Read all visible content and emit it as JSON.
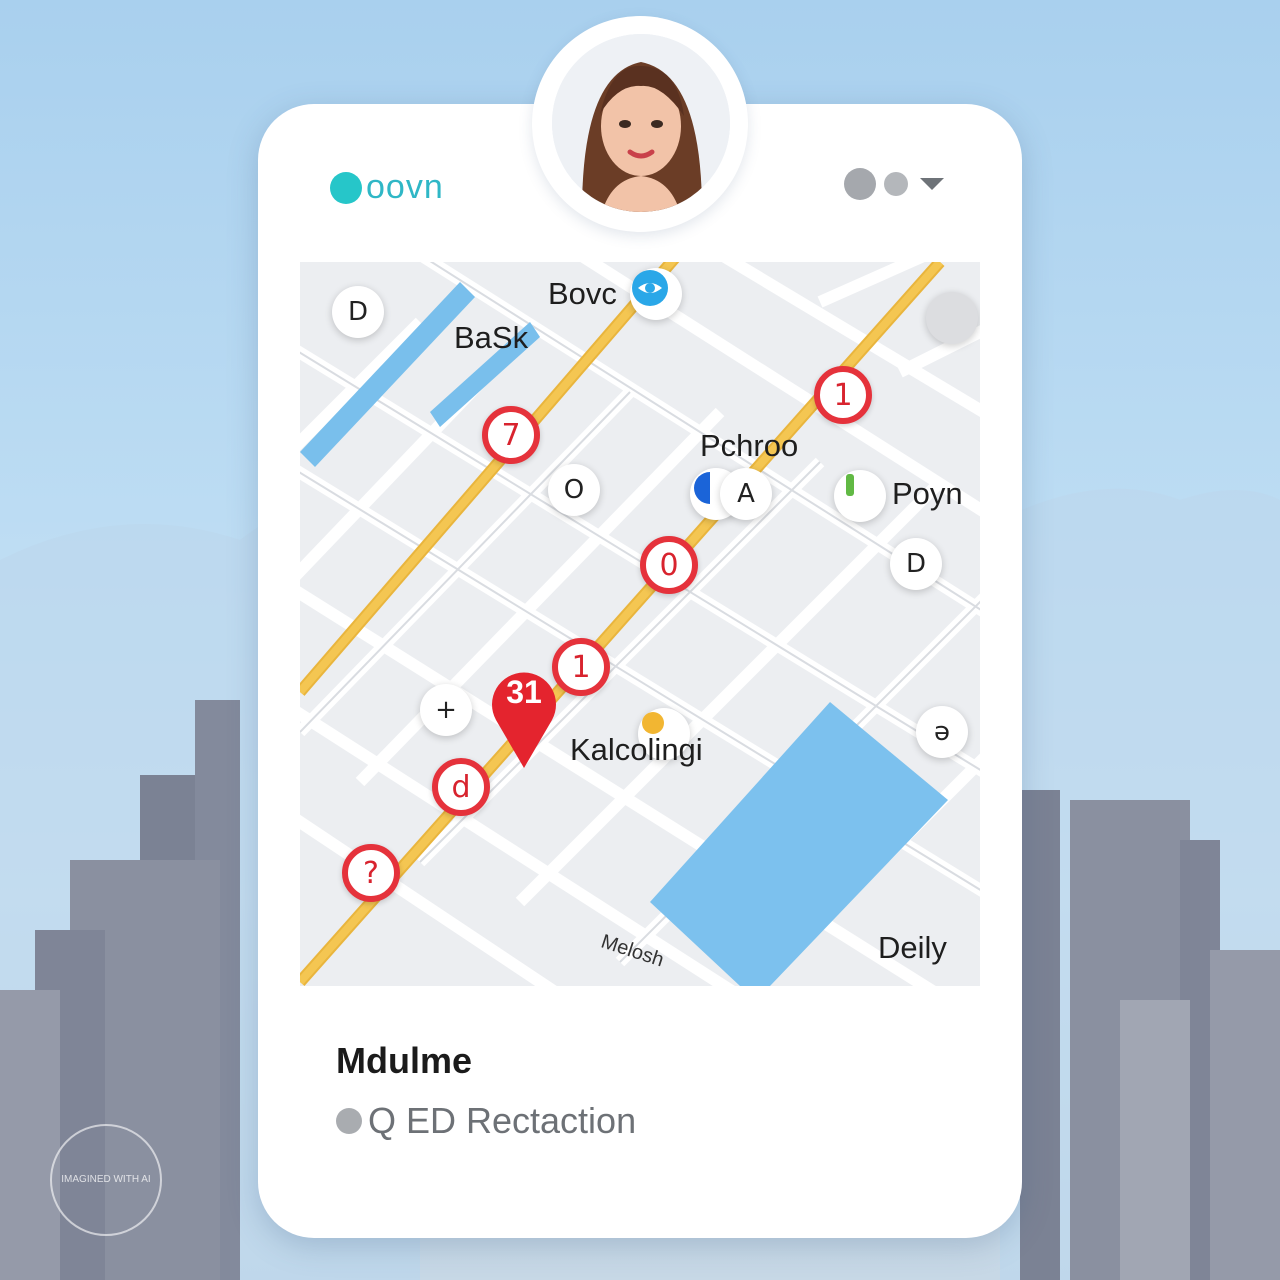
{
  "header": {
    "brand_name": "oovn",
    "brand_color": "#26c6c9",
    "menu_icons": [
      "dot-icon",
      "dot-icon",
      "caret-down-icon"
    ]
  },
  "avatar": {
    "description_icon": "user-avatar"
  },
  "map": {
    "labels": {
      "bovc": "Bovc",
      "bask": "BaSk",
      "pchroo": "Pchroo",
      "poyn": "Poyn",
      "kalcolingi": "Kalcolingi",
      "deily": "Deily",
      "melcsh": "Melosh"
    },
    "red_pins": [
      "7",
      "1",
      "0",
      "1",
      "d",
      "?"
    ],
    "poi_icons": [
      "D",
      "O",
      "D",
      "+",
      "ə",
      "A"
    ],
    "selected_pin": "31",
    "colors": {
      "accent_red": "#e5323b",
      "road_yellow": "#f3c24a",
      "water": "#7cc1ee"
    }
  },
  "footer": {
    "title": "Mdulme",
    "status_text": "Q ED Rectaction"
  },
  "watermark": {
    "text": "IMAGINED WITH AI"
  }
}
